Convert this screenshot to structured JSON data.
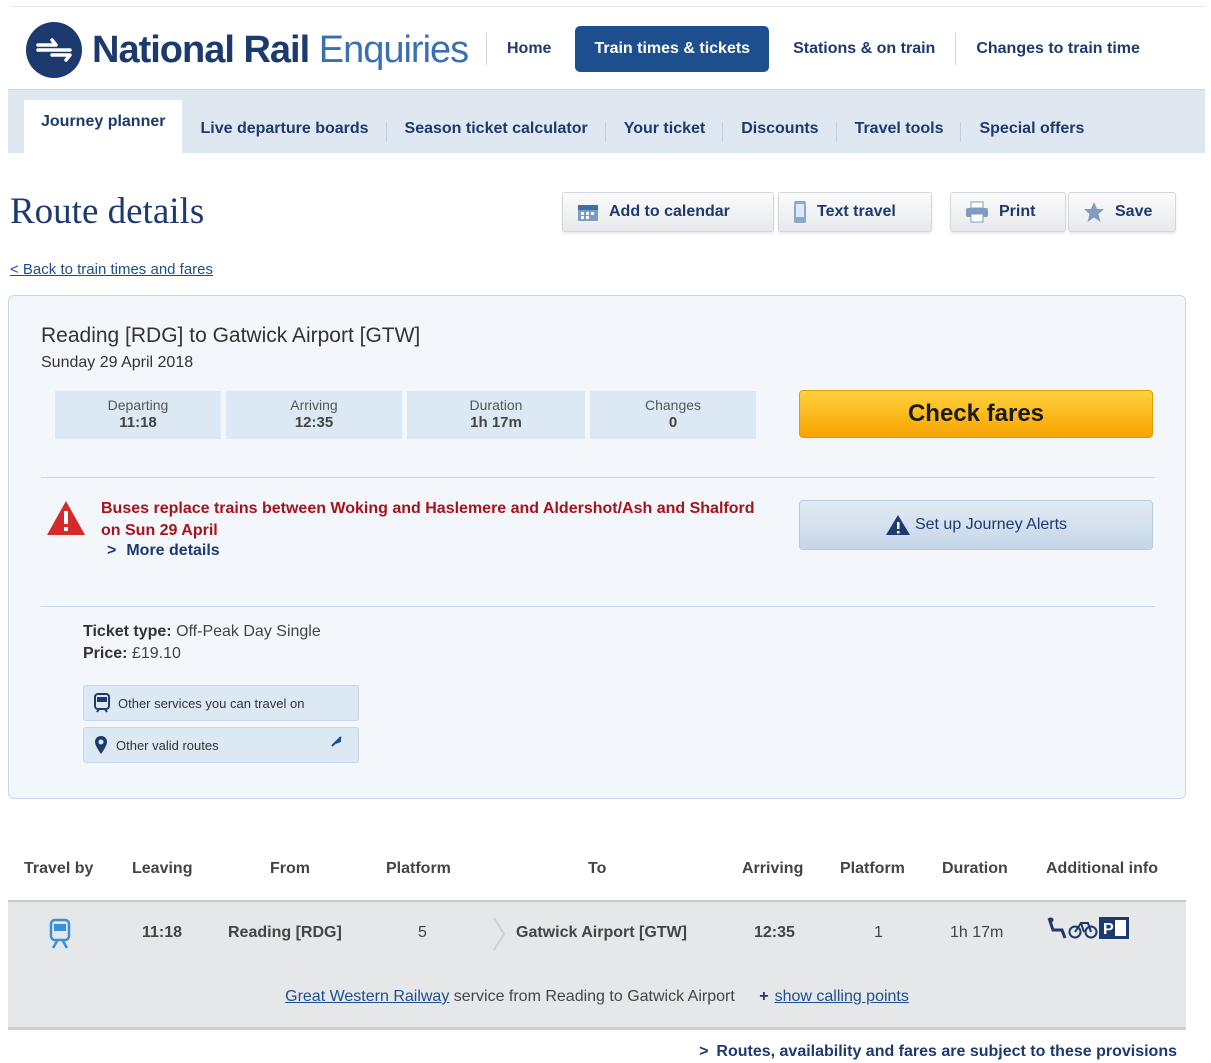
{
  "brand": {
    "name_bold": "National Rail",
    "name_light": "Enquiries"
  },
  "main_nav": [
    "Home",
    "Train times & tickets",
    "Stations & on train",
    "Changes to train time"
  ],
  "sub_nav": [
    "Journey planner",
    "Live departure boards",
    "Season ticket calculator",
    "Your ticket",
    "Discounts",
    "Travel tools",
    "Special offers"
  ],
  "page": {
    "title": "Route details",
    "tools": {
      "calendar": "Add to calendar",
      "text": "Text travel",
      "print": "Print",
      "save": "Save"
    },
    "back_link": "< Back to train times and fares"
  },
  "summary": {
    "route": "Reading [RDG] to Gatwick Airport [GTW]",
    "date": "Sunday 29 April 2018",
    "stats": [
      {
        "label": "Departing",
        "value": "11:18"
      },
      {
        "label": "Arriving",
        "value": "12:35"
      },
      {
        "label": "Duration",
        "value": "1h 17m"
      },
      {
        "label": "Changes",
        "value": "0"
      }
    ],
    "check_fares": "Check fares",
    "alert": "Buses replace trains between Woking and Haslemere and Aldershot/Ash and Shalford on Sun 29 April",
    "more_details": "More details",
    "journey_alerts": "Set up Journey Alerts",
    "ticket_type_label": "Ticket type:",
    "ticket_type": "Off-Peak Day Single",
    "price_label": "Price:",
    "price": "£19.10",
    "other_services": "Other services you can travel on",
    "other_routes": "Other valid routes"
  },
  "table": {
    "headers": [
      "Travel by",
      "Leaving",
      "From",
      "Platform",
      "To",
      "Arriving",
      "Platform",
      "Duration",
      "Additional info"
    ],
    "row": {
      "leaving": "11:18",
      "from": "Reading [RDG]",
      "from_platform": "5",
      "to": "Gatwick Airport [GTW]",
      "arriving": "12:35",
      "to_platform": "1",
      "duration": "1h 17m"
    },
    "service": {
      "operator": "Great Western Railway",
      "text": "service from Reading to Gatwick Airport",
      "calling_points": "show calling points"
    }
  },
  "provisions": "Routes, availability and fares are subject to these provisions",
  "colors": {
    "brand_navy": "#1d3a6e",
    "alert_red": "#a4141c",
    "cta_yellow": "#f7a400"
  }
}
